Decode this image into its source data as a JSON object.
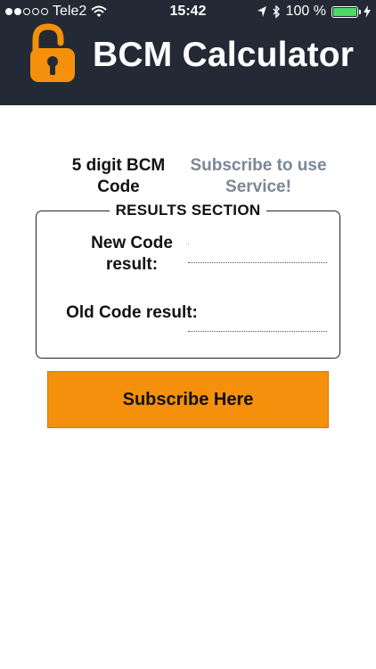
{
  "status_bar": {
    "carrier": "Tele2",
    "time": "15:42",
    "battery_percent": "100 %",
    "battery_level": 1.0,
    "signal_bars_filled": 2,
    "signal_bars_total": 5
  },
  "header": {
    "title": "BCM Calculator",
    "logo_icon": "padlock-icon",
    "background_color": "#232a35",
    "logo_color": "#f4900b"
  },
  "form": {
    "bcm_code_label": "5 digit BCM Code",
    "subscribe_prompt": "Subscribe to use Service!"
  },
  "results": {
    "section_title": "RESULTS SECTION",
    "new_code_label": "New Code result:",
    "new_code_value": "",
    "old_code_label": "Old Code result:",
    "old_code_value": ""
  },
  "actions": {
    "subscribe_button_label": "Subscribe Here",
    "accent_color": "#f4900b"
  }
}
